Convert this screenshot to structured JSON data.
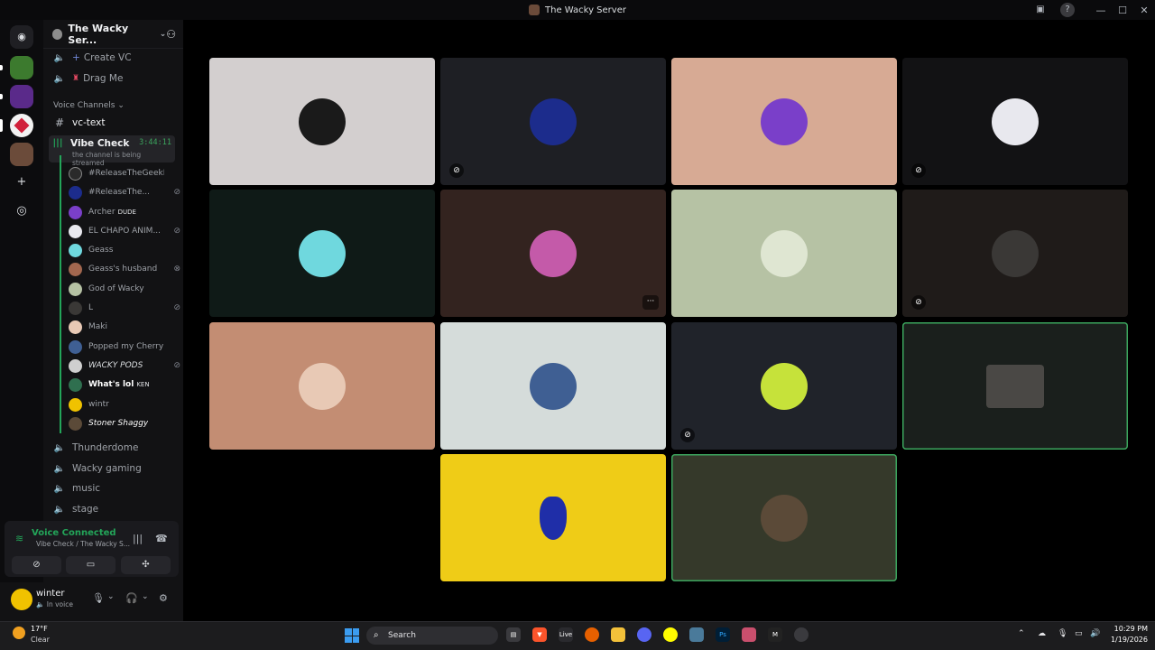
{
  "window": {
    "title": "The Wacky Server"
  },
  "server": {
    "name": "The Wacky Ser..."
  },
  "channels_top": [
    {
      "label": "Create VC"
    },
    {
      "label": "Drag Me"
    }
  ],
  "category": {
    "label": "Voice Channels"
  },
  "text_channel": {
    "label": "vc-text"
  },
  "active_channel": {
    "label": "Vibe Check",
    "timer": "3:44:11",
    "subtitle": "the channel is being streamed"
  },
  "members": [
    {
      "name": "#ReleaseTheGeekFiles",
      "tag": "",
      "color": "#9ea2a8"
    },
    {
      "name": "#ReleaseThe...",
      "tag": "",
      "color": "#9ea2a8"
    },
    {
      "name": "Archer",
      "tag": "DUDE",
      "color": "#9ea2a8"
    },
    {
      "name": "EL CHAPO ANIM...",
      "tag": "",
      "color": "#9ea2a8"
    },
    {
      "name": "Geass",
      "tag": "",
      "color": "#9ea2a8"
    },
    {
      "name": "Geass's husband",
      "tag": "",
      "color": "#9ea2a8"
    },
    {
      "name": "God of Wacky",
      "tag": "",
      "color": "#9ea2a8"
    },
    {
      "name": "L",
      "tag": "",
      "color": "#9ea2a8"
    },
    {
      "name": "Maki",
      "tag": "",
      "color": "#9ea2a8"
    },
    {
      "name": "Popped my Cherry",
      "tag": "",
      "color": "#9ea2a8"
    },
    {
      "name": "WACKY PODS",
      "tag": "",
      "color": "#dbdee1"
    },
    {
      "name": "What's lol",
      "tag": "KEN",
      "color": "#ffffff"
    },
    {
      "name": "wintr",
      "tag": "",
      "color": "#9ea2a8"
    },
    {
      "name": "Stoner Shaggy",
      "tag": "",
      "color": "#ffffff"
    }
  ],
  "channels_bottom": [
    {
      "label": "Thunderdome"
    },
    {
      "label": "Wacky gaming"
    },
    {
      "label": "music"
    },
    {
      "label": "stage"
    }
  ],
  "voice": {
    "status": "Voice Connected",
    "location": "Vibe Check / The Wacky S..."
  },
  "user": {
    "name": "winter",
    "status": "In voice"
  },
  "tiles": [
    {
      "bg": "#d3cfcf",
      "avatar": "#1a1a1a",
      "speaking": false
    },
    {
      "bg": "#1e1f24",
      "avatar": "#1c2c8c",
      "speaking": false
    },
    {
      "bg": "#d7aa94",
      "avatar": "#7a3fc9",
      "speaking": false
    },
    {
      "bg": "#121214",
      "avatar": "#e8e8ee",
      "speaking": false
    },
    {
      "bg": "#0f1a17",
      "avatar": "#6fd8de",
      "speaking": false
    },
    {
      "bg": "#33231f",
      "avatar": "#c45aa9",
      "speaking": false
    },
    {
      "bg": "#b6c2a4",
      "avatar": "#dfe6d2",
      "speaking": false
    },
    {
      "bg": "#1f1b19",
      "avatar": "#3a3836",
      "speaking": false
    },
    {
      "bg": "#c38d73",
      "avatar": "#e8c9b5",
      "speaking": false
    },
    {
      "bg": "#d5dcda",
      "avatar": "#3f5f93",
      "speaking": false
    },
    {
      "bg": "#20232a",
      "avatar": "#c6e23a",
      "speaking": false
    },
    {
      "bg": "#1a1f1c",
      "avatar": "#4a4845",
      "speaking": true
    },
    {
      "bg": "#efcc17",
      "avatar": "#1f2ea8",
      "speaking": false
    },
    {
      "bg": "#35392a",
      "avatar": "#5b4a38",
      "speaking": true
    }
  ],
  "taskbar": {
    "weather_temp": "17°F",
    "weather_cond": "Clear",
    "search_label": "Search",
    "time": "10:29 PM",
    "date": "1/19/2026",
    "live_label": "Live",
    "ps_label": "Ps",
    "m_label": "M"
  }
}
